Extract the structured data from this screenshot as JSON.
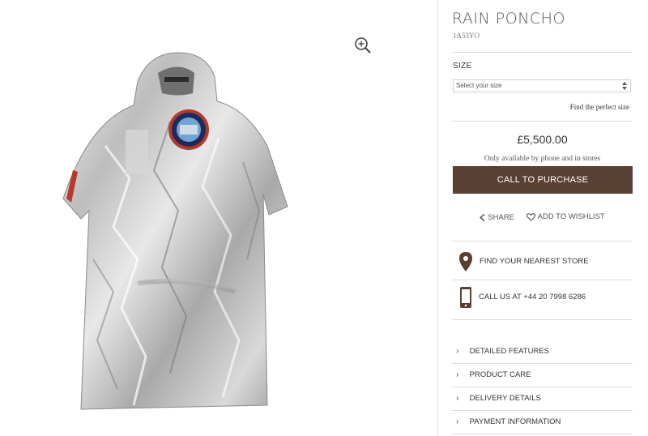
{
  "product": {
    "title": "RAIN PONCHO",
    "sku": "1A53YO"
  },
  "size": {
    "label": "SIZE",
    "select_placeholder": "Select your size",
    "find_size_link": "Find the perfect size"
  },
  "price": {
    "amount": "£5,500.00",
    "availability": "Only available by phone and in stores"
  },
  "actions": {
    "call_to_purchase": "CALL TO PURCHASE",
    "share": "SHARE",
    "add_to_wishlist": "ADD TO WISHLIST"
  },
  "contact": {
    "find_store": "FIND YOUR NEAREST STORE",
    "call_us": "CALL US AT +44 20 7998 6286"
  },
  "accordion": [
    {
      "label": "DETAILED FEATURES"
    },
    {
      "label": "PRODUCT CARE"
    },
    {
      "label": "DELIVERY DETAILS"
    },
    {
      "label": "PAYMENT INFORMATION"
    }
  ],
  "colors": {
    "cta_background": "#5a4032",
    "icon_brown": "#5a4032"
  },
  "icons": {
    "zoom": "zoom-in-icon",
    "share": "share-chevron-icon",
    "wishlist": "heart-icon",
    "store": "location-pin-icon",
    "phone": "phone-icon",
    "accordion": "chevron-right-icon"
  }
}
